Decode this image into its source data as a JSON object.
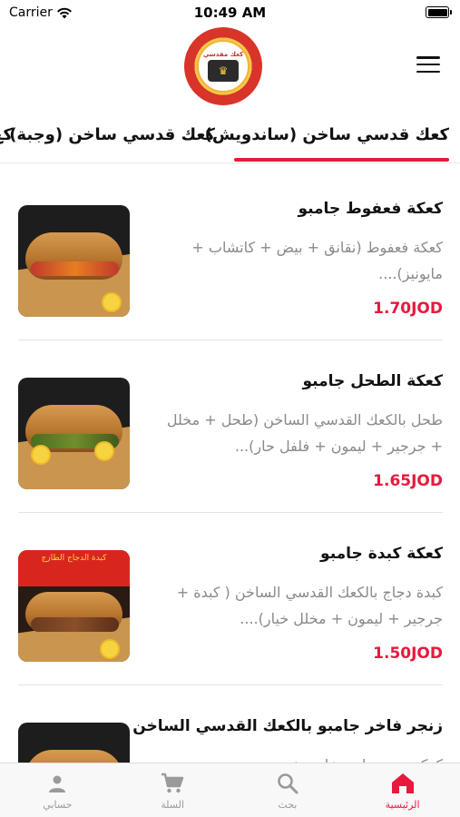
{
  "status_bar": {
    "carrier": "Carrier",
    "time": "10:49 AM"
  },
  "header": {
    "logo_text": "كعك مقدسي"
  },
  "tabs": [
    {
      "label": "كعك قدسي ساخن (ساندويش)"
    },
    {
      "label": "كعك قدسي ساخن (وجبة)"
    },
    {
      "label": "كع"
    }
  ],
  "menu_items": [
    {
      "title": "كعكة فعفوط جامبو",
      "description": "كعكة فعفوط (نقانق + بيض + كاتشاب + مايونيز)....",
      "price": "1.70JOD"
    },
    {
      "title": "كعكة الطحل جامبو",
      "description": "طحل بالكعك القدسي الساخن (طحل + مخلل + جرجير + ليمون + فلفل حار)...",
      "price": "1.65JOD"
    },
    {
      "title": "كعكة كبدة جامبو",
      "description": "كبدة دجاج بالكعك القدسي الساخن ( كبدة + جرجير + ليمون + مخلل خيار)....",
      "price": "1.50JOD",
      "image_text": "كبدة الدجاج الطازج"
    },
    {
      "title": "زنجر فاخر جامبو بالكعك القدسي الساخن",
      "description": "كعكة زنجر جامبو علوي خس",
      "price": ""
    }
  ],
  "bottom_nav": [
    {
      "label": "الرئيسية",
      "icon": "home-icon",
      "active": true
    },
    {
      "label": "بحث",
      "icon": "search-icon",
      "active": false
    },
    {
      "label": "السلة",
      "icon": "cart-icon",
      "active": false
    },
    {
      "label": "حسابي",
      "icon": "user-icon",
      "active": false
    }
  ],
  "colors": {
    "accent": "#e8193d",
    "inactive": "#9a9a9a"
  }
}
